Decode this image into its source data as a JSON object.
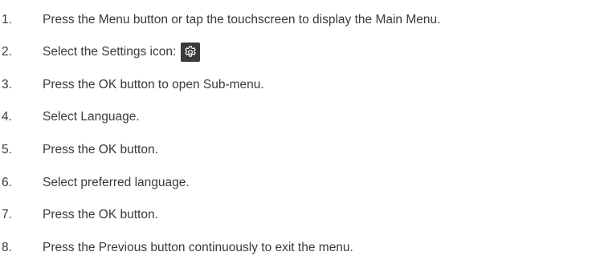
{
  "instructions": {
    "steps": [
      {
        "number": "1.",
        "text": "Press the Menu button or tap the touchscreen to display the Main Menu."
      },
      {
        "number": "2.",
        "text": "Select the Settings icon:",
        "icon": "settings-gear-icon"
      },
      {
        "number": "3.",
        "text": "Press the OK button to open Sub-menu."
      },
      {
        "number": "4.",
        "text": "Select Language."
      },
      {
        "number": "5.",
        "text": "Press the OK button."
      },
      {
        "number": "6.",
        "text": "Select preferred language."
      },
      {
        "number": "7.",
        "text": "Press the OK button."
      },
      {
        "number": "8.",
        "text": "Press the Previous button continuously to exit the menu."
      }
    ]
  },
  "colors": {
    "text": "#3a3a3a",
    "icon_background": "#3a3a3a",
    "icon_foreground": "#ffffff"
  }
}
